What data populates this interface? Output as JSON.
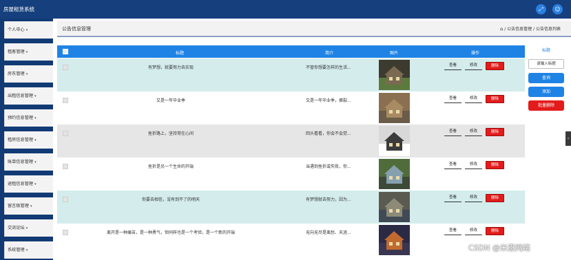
{
  "app": {
    "title": "房屋租赁系统"
  },
  "topbar": {
    "fullscreen_icon": "expand-icon",
    "user_icon": "user-icon",
    "accent": "#2a7fe0"
  },
  "sidebar": {
    "items": [
      {
        "label": "个人中心"
      },
      {
        "label": "租客管理"
      },
      {
        "label": "房东管理"
      },
      {
        "label": "出租信息管理"
      },
      {
        "label": "预约信息管理"
      },
      {
        "label": "租房信息管理"
      },
      {
        "label": "账单信息管理"
      },
      {
        "label": "退租信息管理"
      },
      {
        "label": "留言板管理"
      },
      {
        "label": "交流论坛"
      },
      {
        "label": "系统管理"
      }
    ],
    "caret": "▾"
  },
  "header": {
    "page_title": "公告信息管理",
    "breadcrumb": "/ 公告信息管理 / 公告信息列表",
    "home_icon": "home-icon"
  },
  "table": {
    "columns": {
      "title": "标题",
      "intro": "简介",
      "image": "图片",
      "actions": "操作"
    },
    "rows": [
      {
        "title": "有梦想，就要努力去实现",
        "intro": "不管你想要怎样的生活...",
        "bg": "#d4ecec",
        "thumb": [
          "#3d3a30",
          "#7a6a52",
          "#5d7a3e"
        ]
      },
      {
        "title": "又是一年毕业季",
        "intro": "又是一年毕业季，撕裂...",
        "bg": "#ffffff",
        "thumb": [
          "#8a7050",
          "#a88b62",
          "#6a5c48"
        ]
      },
      {
        "title": "挫折路上，坚持常在心间",
        "intro": "回头看看，你会不会觉...",
        "bg": "#e6e6e6",
        "thumb": [
          "#d8d8d8",
          "#3b3b3b",
          "#ffffff"
        ]
      },
      {
        "title": "挫折是另一个生命的开端",
        "intro": "当遇到挫折或失败，你...",
        "bg": "#ffffff",
        "thumb": [
          "#4f6c3a",
          "#86a0b0",
          "#3d4a38"
        ]
      },
      {
        "title": "你要去相信，没有到不了的明天",
        "intro": "有梦想就去努力，因为...",
        "bg": "#d4ecec",
        "thumb": [
          "#5a5a50",
          "#8d8a78",
          "#3f4a55"
        ]
      },
      {
        "title": "离开是一种痛苦，是一种勇气，但同样也是一个考验，是一个新的开端",
        "intro": "无向无尽是离愁、天涯...",
        "bg": "#ffffff",
        "thumb": [
          "#2a2a45",
          "#c06a30",
          "#3a3550"
        ]
      }
    ],
    "actions": {
      "view": "查看",
      "edit": "修改",
      "delete": "删除"
    }
  },
  "search_panel": {
    "label": "标题",
    "placeholder": "请输入标题",
    "query_btn": "查询",
    "add_btn": "添加",
    "batch_delete_btn": "批量删除",
    "colors": {
      "primary": "#1f83e6",
      "danger": "#e31b1b"
    }
  },
  "watermark": "CSDN @米恩网络"
}
